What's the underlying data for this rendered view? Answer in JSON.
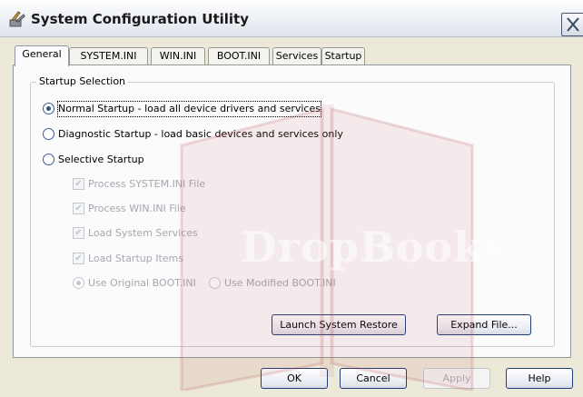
{
  "window": {
    "title": "System Configuration Utility"
  },
  "tabs": [
    {
      "label": "General",
      "active": true
    },
    {
      "label": "SYSTEM.INI"
    },
    {
      "label": "WIN.INI"
    },
    {
      "label": "BOOT.INI"
    },
    {
      "label": "Services"
    },
    {
      "label": "Startup"
    }
  ],
  "general": {
    "group_label": "Startup Selection",
    "normal_startup": "Normal Startup - load all device drivers and services",
    "diagnostic_startup": "Diagnostic Startup - load basic devices and services only",
    "selective_startup": "Selective Startup",
    "process_system_ini": "Process SYSTEM.INI File",
    "process_win_ini": "Process WIN.INI File",
    "load_system_services": "Load System Services",
    "load_startup_items": "Load Startup Items",
    "use_original_boot": "Use Original BOOT.INI",
    "use_modified_boot": "Use Modified BOOT.INI",
    "launch_system_restore": "Launch System Restore",
    "expand_file": "Expand File..."
  },
  "footer": {
    "ok": "OK",
    "cancel": "Cancel",
    "apply": "Apply",
    "help": "Help"
  },
  "watermark": {
    "text": "DropBooks"
  }
}
